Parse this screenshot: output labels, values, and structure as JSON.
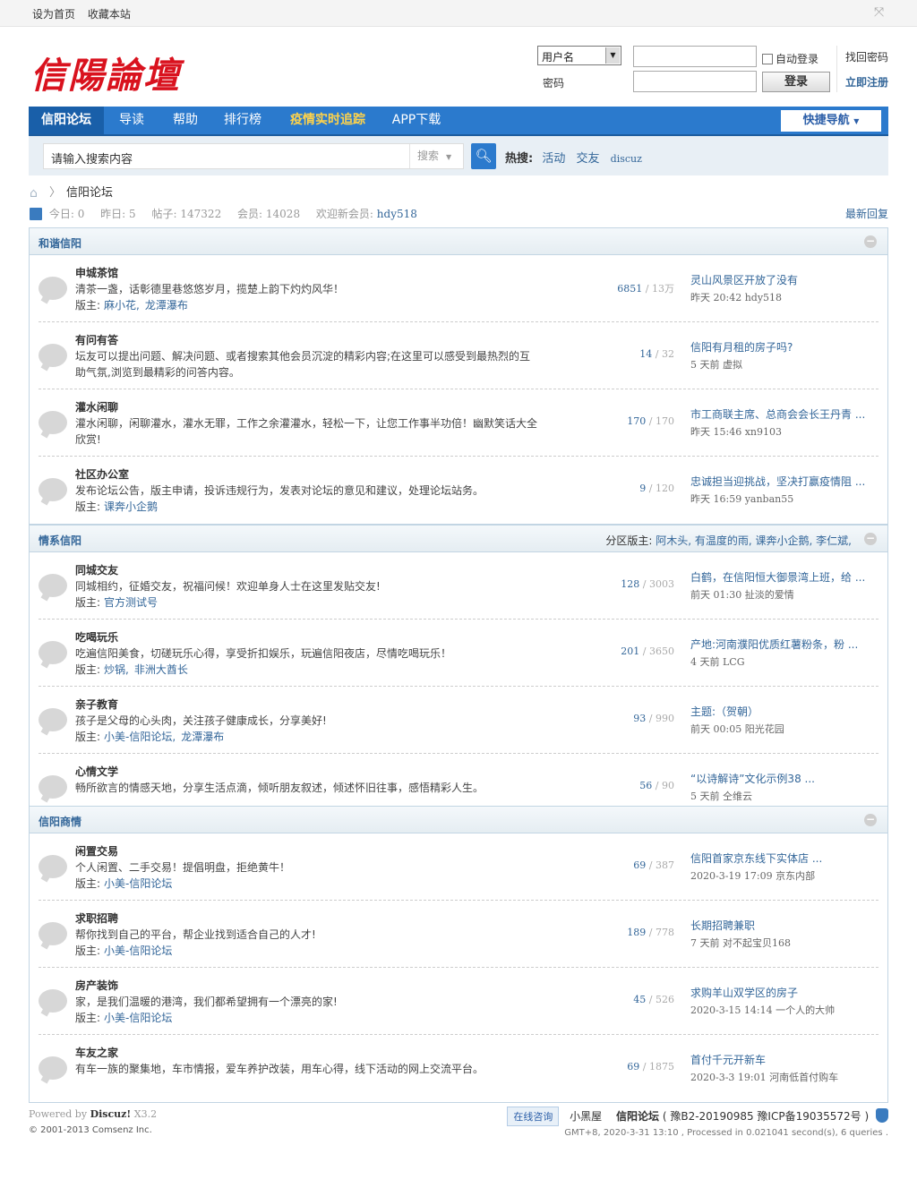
{
  "topbar": {
    "set_home": "设为首页",
    "bookmark": "收藏本站"
  },
  "logo": "信陽論壇",
  "login": {
    "user_select": "用户名",
    "password_label": "密码",
    "auto_login": "自动登录",
    "login_button": "登录",
    "find_password": "找回密码",
    "register": "立即注册"
  },
  "nav": {
    "items": [
      "信阳论坛",
      "导读",
      "帮助",
      "排行榜",
      "疫情实时追踪",
      "APP下载"
    ],
    "quick": "快捷导航"
  },
  "search": {
    "placeholder": "请输入搜索内容",
    "type": "搜索",
    "hot_label": "热搜:",
    "hot": [
      "活动",
      "交友",
      "discuz"
    ]
  },
  "breadcrumb": {
    "current": "信阳论坛"
  },
  "stats": {
    "today_label": "今日:",
    "today": "0",
    "yesterday_label": "昨日:",
    "yesterday": "5",
    "posts_label": "帖子:",
    "posts": "147322",
    "members_label": "会员:",
    "members": "14028",
    "new_member_label": "欢迎新会员:",
    "new_member": "hdy518",
    "latest_reply": "最新回复"
  },
  "sections": [
    {
      "title": "和谐信阳",
      "moderators": "",
      "forums": [
        {
          "name": "申城茶馆",
          "desc": "清茶一盏，话彰德里巷悠悠岁月，揽楚上韵下灼灼风华！",
          "mods_label": "版主:",
          "mods": [
            "麻小花,",
            "龙潭瀑布"
          ],
          "threads": "6851",
          "posts": "13万",
          "last_title": "灵山风景区开放了没有",
          "last_meta": "昨天 20:42 hdy518"
        },
        {
          "name": "有问有答",
          "desc": "坛友可以提出问题、解决问题、或者搜索其他会员沉淀的精彩内容;在这里可以感受到最热烈的互助气氛,浏览到最精彩的问答内容。",
          "mods_label": "",
          "mods": [],
          "threads": "14",
          "posts": "32",
          "last_title": "信阳有月租的房子吗?",
          "last_meta": "5 天前 虚拟"
        },
        {
          "name": "灌水闲聊",
          "desc": "灌水闲聊，闲聊灌水，灌水无罪，工作之余灌灌水，轻松一下，让您工作事半功倍！幽默笑话大全欣赏!",
          "mods_label": "",
          "mods": [],
          "threads": "170",
          "posts": "170",
          "last_title": "市工商联主席、总商会会长王丹青 ...",
          "last_meta": "昨天 15:46 xn9103"
        },
        {
          "name": "社区办公室",
          "desc": "发布论坛公告，版主申请，投诉违规行为，发表对论坛的意见和建议，处理论坛站务。",
          "mods_label": "版主:",
          "mods": [
            "课奔小企鹅"
          ],
          "threads": "9",
          "posts": "120",
          "last_title": "忠诚担当迎挑战，坚决打赢疫情阻 ...",
          "last_meta": "昨天 16:59 yanban55"
        }
      ]
    },
    {
      "title": "情系信阳",
      "moderators_label": "分区版主:",
      "moderators": "阿木头, 有温度的雨, 课奔小企鹅, 李仁斌,",
      "forums": [
        {
          "name": "同城交友",
          "desc": "同城相约，征婚交友，祝福问候！欢迎单身人士在这里发贴交友!",
          "mods_label": "版主:",
          "mods": [
            "官方测试号"
          ],
          "threads": "128",
          "posts": "3003",
          "last_title": "白鹤，在信阳恒大御景湾上班，给 ...",
          "last_meta": "前天 01:30 扯淡的爱情"
        },
        {
          "name": "吃喝玩乐",
          "desc": "吃遍信阳美食，切磋玩乐心得，享受折扣娱乐，玩遍信阳夜店，尽情吃喝玩乐！",
          "mods_label": "版主:",
          "mods": [
            "炒锅,",
            "非洲大酋长"
          ],
          "threads": "201",
          "posts": "3650",
          "last_title": "产地:河南濮阳优质红薯粉条，粉 ...",
          "last_meta": "4 天前 LCG"
        },
        {
          "name": "亲子教育",
          "desc": "孩子是父母的心头肉，关注孩子健康成长，分享美好!",
          "mods_label": "版主:",
          "mods": [
            "小美-信阳论坛,",
            "龙潭瀑布"
          ],
          "threads": "93",
          "posts": "990",
          "last_title": "主题:（贺朝）",
          "last_meta": "前天 00:05 阳光花园"
        },
        {
          "name": "心情文学",
          "desc": "畅所欲言的情感天地，分享生活点滴，倾听朋友叙述，倾述怀旧往事，感悟精彩人生。",
          "mods_label": "",
          "mods": [],
          "threads": "56",
          "posts": "90",
          "last_title": "“以诗解诗”文化示例38 ...",
          "last_meta": "5 天前 仝维云"
        }
      ]
    },
    {
      "title": "信阳商情",
      "moderators": "",
      "forums": [
        {
          "name": "闲置交易",
          "desc": "个人闲置、二手交易！提倡明盘，拒绝黄牛！",
          "mods_label": "版主:",
          "mods": [
            "小美-信阳论坛"
          ],
          "threads": "69",
          "posts": "387",
          "last_title": "信阳首家京东线下实体店 ...",
          "last_meta": "2020-3-19 17:09 京东内部"
        },
        {
          "name": "求职招聘",
          "desc": "帮你找到自己的平台，帮企业找到适合自己的人才!",
          "mods_label": "版主:",
          "mods": [
            "小美-信阳论坛"
          ],
          "threads": "189",
          "posts": "778",
          "last_title": "长期招聘兼职",
          "last_meta": "7 天前 对不起宝贝168"
        },
        {
          "name": "房产装饰",
          "desc": "家，是我们温暖的港湾，我们都希望拥有一个漂亮的家!",
          "mods_label": "版主:",
          "mods": [
            "小美-信阳论坛"
          ],
          "threads": "45",
          "posts": "526",
          "last_title": "求购羊山双学区的房子",
          "last_meta": "2020-3-15 14:14 一个人的大帅"
        },
        {
          "name": "车友之家",
          "desc": "有车一族的聚集地，车市情报，爱车养护改装，用车心得，线下活动的网上交流平台。",
          "mods_label": "",
          "mods": [],
          "threads": "69",
          "posts": "1875",
          "last_title": "首付千元开新车",
          "last_meta": "2020-3-3 19:01 河南低首付购车"
        }
      ]
    }
  ],
  "footer": {
    "powered_by": "Powered by",
    "discuz": "Discuz!",
    "version": "X3.2",
    "copyright": "© 2001-2013 Comsenz Inc.",
    "consult": "在线咨询",
    "xiaoheiwu": "小黑屋",
    "site": "信阳论坛",
    "icp": "( 豫B2-20190985 豫ICP备19035572号 )",
    "gmt": "GMT+8, 2020-3-31 13:10 , Processed in 0.021041 second(s), 6 queries ."
  }
}
